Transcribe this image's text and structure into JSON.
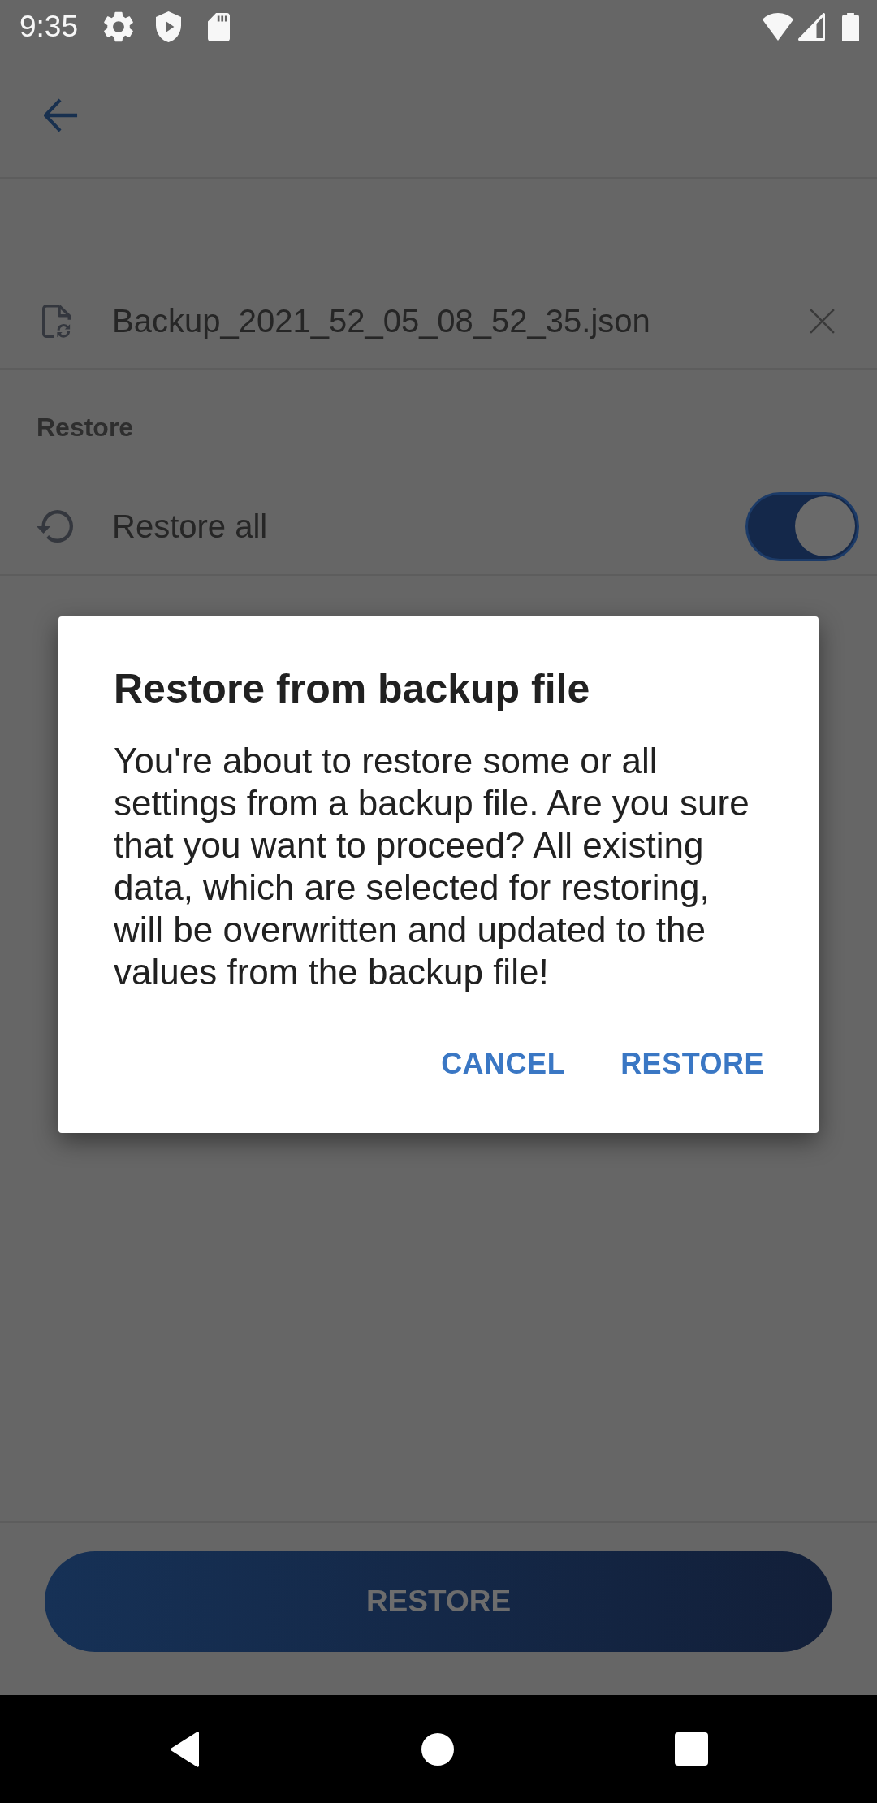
{
  "status_bar": {
    "time": "9:35"
  },
  "file": {
    "name": "Backup_2021_52_05_08_52_35.json"
  },
  "restore_section": {
    "title": "Restore",
    "items": [
      {
        "label": "Restore all",
        "on": true
      }
    ]
  },
  "dialog": {
    "title": "Restore from backup file",
    "message": "You're about to restore some or all settings from a backup file. Are you sure that you want to proceed? All existing data, which are selected for restoring, will be overwritten and updated to the values from the backup file!",
    "buttons": [
      {
        "label": "CANCEL"
      },
      {
        "label": "RESTORE"
      }
    ]
  },
  "bottom_button": {
    "label": "RESTORE"
  }
}
